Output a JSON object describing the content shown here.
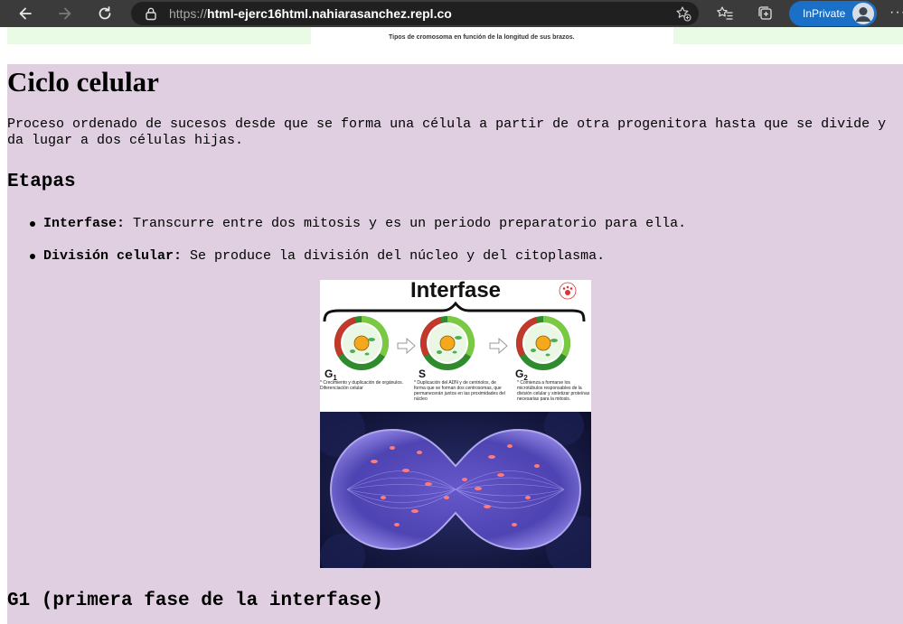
{
  "browser": {
    "url_protocol": "https://",
    "url_host": "html-ejerc16html.nahiarasanchez.repl.co",
    "inprivate_label": "InPrivate",
    "more_label": "···"
  },
  "previous_section": {
    "figure_caption": "Tipos de cromosoma en función de la longitud de sus brazos."
  },
  "section": {
    "title": "Ciclo celular",
    "intro": "Proceso ordenado de sucesos desde que se forma una célula a partir de otra progenitora hasta que se divide y da lugar a dos células hijas.",
    "stages_heading": "Etapas",
    "stages": [
      {
        "term": "Interfase:",
        "text": " Transcurre entre dos mitosis y es un periodo preparatorio para ella."
      },
      {
        "term": "División celular:",
        "text": " Se produce la división del núcleo y del citoplasma."
      }
    ],
    "figure_interfase": {
      "title": "Interfase",
      "phases": [
        {
          "label": "G",
          "sub": "1",
          "note": "* Crecimiento y duplicación de orgánulos. Diferenciación celular"
        },
        {
          "label": "S",
          "sub": "",
          "note": "* Duplicación del ADN y de centriolos, de forma que se forman dos centrosomas, que permanecerán juntos en las proximidades del núcleo"
        },
        {
          "label": "G",
          "sub": "2",
          "note": "* Comienza a formarse los microtúbulos responsables de la división celular y sintetizar proteínas necesarias para la mitosis."
        }
      ]
    },
    "next_heading": "G1 (primera fase de la interfase)"
  }
}
